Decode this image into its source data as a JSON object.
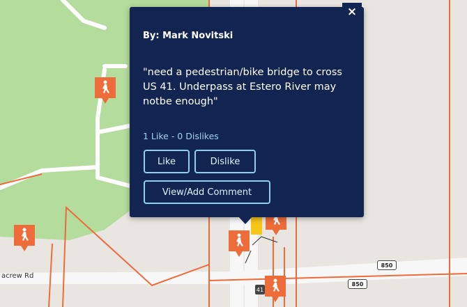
{
  "map": {
    "road_label": "acrew Rd",
    "shield_850_a": "850",
    "shield_850_b": "850",
    "shield_41": "41",
    "colors": {
      "park": "#b4dc9c",
      "land": "#e9e6e2",
      "marker": "#ee6b3a",
      "boundary": "#ee6b3a",
      "road_highlight": "#f5c518"
    },
    "markers": [
      {
        "name": "pedestrian-marker",
        "icon": "pedestrian-icon"
      },
      {
        "name": "pedestrian-marker",
        "icon": "pedestrian-icon"
      },
      {
        "name": "pedestrian-marker",
        "icon": "pedestrian-icon"
      },
      {
        "name": "pedestrian-marker",
        "icon": "pedestrian-icon"
      },
      {
        "name": "pedestrian-marker",
        "icon": "pedestrian-icon"
      }
    ]
  },
  "popup": {
    "author": "By: Mark Novitski",
    "comment": "\"need a pedestrian/bike bridge to cross US 41. Underpass at Estero River may notbe enough\"",
    "votes": "1 Like - 0 Dislikes",
    "like_label": "Like",
    "dislike_label": "Dislike",
    "view_add_label": "View/Add Comment",
    "close_glyph": "×"
  }
}
